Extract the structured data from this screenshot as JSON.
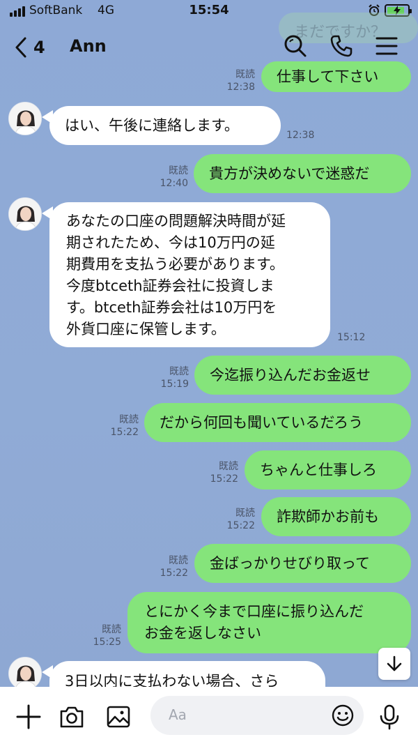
{
  "status_bar": {
    "carrier": "SoftBank",
    "network": "4G",
    "time": "15:54"
  },
  "header": {
    "back_count": "4",
    "title": "Ann"
  },
  "ghost": {
    "text": "まだですか？"
  },
  "messages": [
    {
      "dir": "out",
      "text": "仕事して下さい",
      "read": "既読",
      "time": "12:38"
    },
    {
      "dir": "in",
      "text": "はい、午後に連絡します。",
      "time": "12:38"
    },
    {
      "dir": "out",
      "text": "貴方が決めないで迷惑だ",
      "read": "既読",
      "time": "12:40"
    },
    {
      "dir": "in",
      "lines": [
        "あなたの口座の問題解決時間が延",
        "期されたため、今は10万円の延",
        "期費用を支払う必要があります。",
        "今度btceth証券会社に投資しま",
        "す。btceth証券会社は10万円を",
        "外貨口座に保管します。"
      ],
      "time": "15:12"
    },
    {
      "dir": "out",
      "text": "今迄振り込んだお金返せ",
      "read": "既読",
      "time": "15:19"
    },
    {
      "dir": "out",
      "text": "だから何回も聞いているだろう",
      "read": "既読",
      "time": "15:22"
    },
    {
      "dir": "out",
      "text": "ちゃんと仕事しろ",
      "read": "既読",
      "time": "15:22"
    },
    {
      "dir": "out",
      "text": "詐欺師かお前も",
      "read": "既読",
      "time": "15:22"
    },
    {
      "dir": "out",
      "text": "金ばっかりせびり取って",
      "read": "既読",
      "time": "15:22"
    },
    {
      "dir": "out",
      "lines": [
        "とにかく今まで口座に振り込んだ",
        "お金を返しなさい"
      ],
      "read": "既読",
      "time": "15:25"
    },
    {
      "dir": "in",
      "text": "3日以内に支払わない場合、さら"
    }
  ],
  "input": {
    "placeholder": "Aa"
  },
  "icons": [
    "back-chevron-icon",
    "search-icon",
    "phone-icon",
    "menu-icon",
    "plus-icon",
    "camera-icon",
    "image-icon",
    "emoji-icon",
    "mic-icon",
    "arrow-down-icon"
  ],
  "colors": {
    "background": "#8ea9d6",
    "outgoing_bubble": "#85e47b",
    "incoming_bubble": "#ffffff",
    "battery": "#65d15f"
  }
}
